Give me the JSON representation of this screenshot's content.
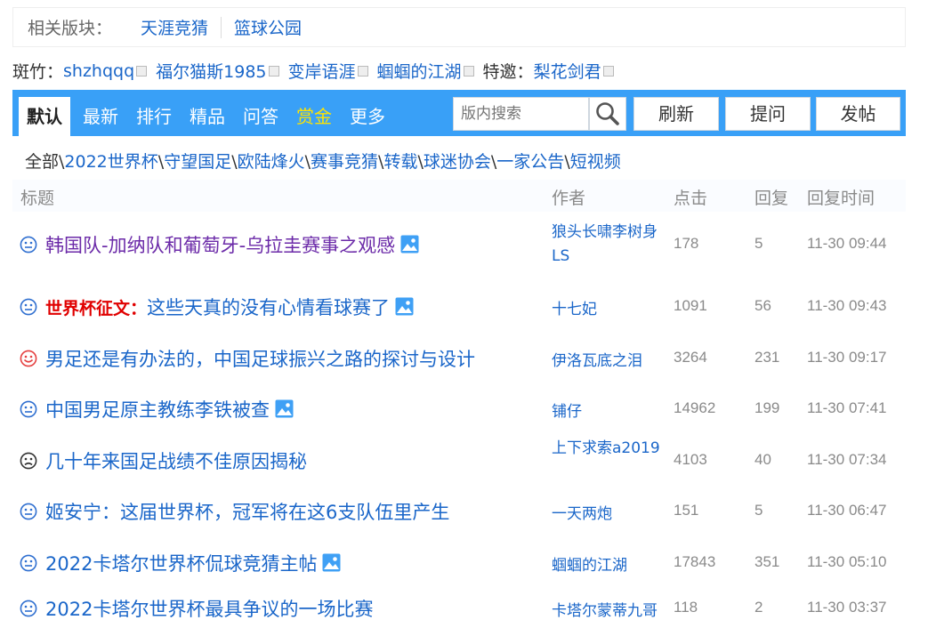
{
  "related": {
    "label": "相关版块：",
    "links": [
      "天涯竞猜",
      "篮球公园"
    ]
  },
  "moderators": {
    "label": "斑竹：",
    "names": [
      "shzhqqq",
      "福尔猫斯1985",
      "变岸语涯",
      "蝈蝈的江湖"
    ],
    "guest_label": "特邀：",
    "guests": [
      "梨花剑君"
    ]
  },
  "tabs": [
    "默认",
    "最新",
    "排行",
    "精品",
    "问答",
    "赏金",
    "更多"
  ],
  "search": {
    "placeholder": "版内搜索"
  },
  "buttons": {
    "refresh": "刷新",
    "ask": "提问",
    "post": "发帖"
  },
  "categories": [
    "全部",
    "2022世界杯",
    "守望国足",
    "欧陆烽火",
    "赛事竞猜",
    "转载",
    "球迷协会",
    "一家公告",
    "短视频"
  ],
  "table": {
    "headers": {
      "title": "标题",
      "author": "作者",
      "clicks": "点击",
      "replies": "回复",
      "time": "回复时间"
    },
    "rows": [
      {
        "mood": "neutral",
        "prefix": "",
        "title": "韩国队-加纳队和葡萄牙-乌拉圭赛事之观感",
        "has_image": true,
        "visited": true,
        "author": "狼头长啸李树身LS",
        "clicks": "178",
        "replies": "5",
        "time": "11-30 09:44"
      },
      {
        "mood": "neutral",
        "prefix": "世界杯征文：",
        "title": "这些天真的没有心情看球赛了",
        "has_image": true,
        "visited": false,
        "author": "十七妃",
        "clicks": "1091",
        "replies": "56",
        "time": "11-30 09:43"
      },
      {
        "mood": "happy",
        "prefix": "",
        "title": "男足还是有办法的，中国足球振兴之路的探讨与设计",
        "has_image": false,
        "visited": false,
        "author": "伊洛瓦底之泪",
        "clicks": "3264",
        "replies": "231",
        "time": "11-30 09:17"
      },
      {
        "mood": "neutral",
        "prefix": "",
        "title": "中国男足原主教练李铁被查",
        "has_image": true,
        "visited": false,
        "author": "铺仔",
        "clicks": "14962",
        "replies": "199",
        "time": "11-30 07:41"
      },
      {
        "mood": "sad",
        "prefix": "",
        "title": "几十年来国足战绩不佳原因揭秘",
        "has_image": false,
        "visited": false,
        "author": "上下求索a2019",
        "clicks": "4103",
        "replies": "40",
        "time": "11-30 07:34"
      },
      {
        "mood": "neutral",
        "prefix": "",
        "title": "姬安宁：这届世界杯，冠军将在这6支队伍里产生",
        "has_image": false,
        "visited": false,
        "author": "一天两炮",
        "clicks": "151",
        "replies": "5",
        "time": "11-30 06:47"
      },
      {
        "mood": "neutral",
        "prefix": "",
        "title": "2022卡塔尔世界杯侃球竞猜主帖",
        "has_image": true,
        "visited": false,
        "author": "蝈蝈的江湖",
        "clicks": "17843",
        "replies": "351",
        "time": "11-30 05:10"
      },
      {
        "mood": "neutral",
        "prefix": "",
        "title": "2022卡塔尔世界杯最具争议的一场比赛",
        "has_image": false,
        "visited": false,
        "author": "卡塔尔蒙蒂九哥",
        "clicks": "118",
        "replies": "2",
        "time": "11-30 03:37"
      }
    ]
  },
  "colors": {
    "accent": "#39a0f7",
    "link": "#1a66c9",
    "visited": "#6b2aa8",
    "prefix": "#e00000",
    "gold": "#ffe400",
    "muted": "#8a8a8a"
  }
}
